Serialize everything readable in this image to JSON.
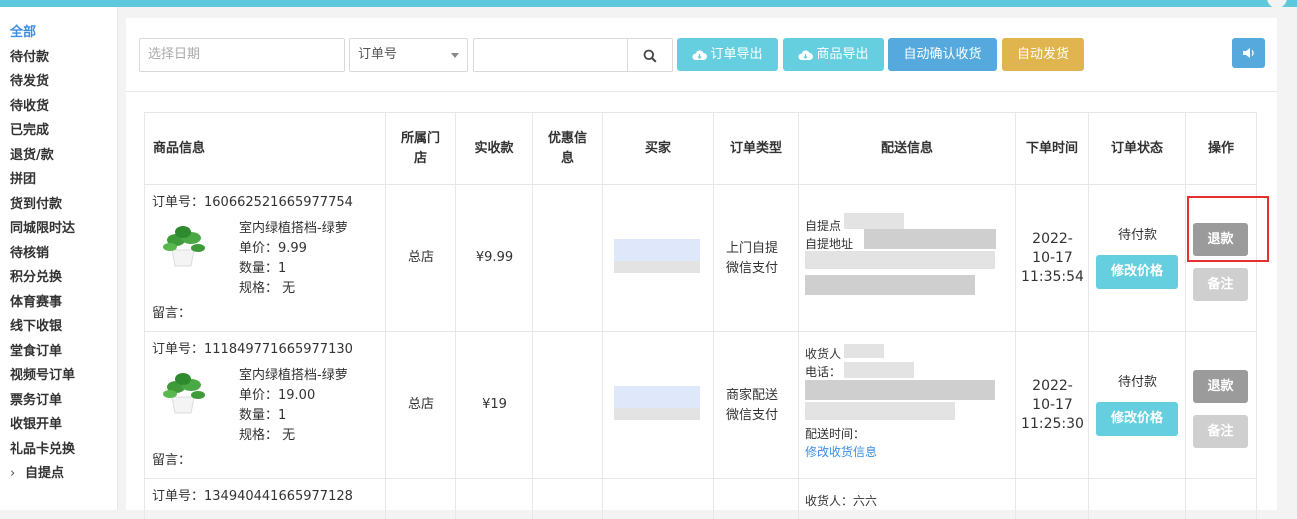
{
  "sidebar": {
    "items": [
      {
        "label": "全部",
        "active": true
      },
      {
        "label": "待付款"
      },
      {
        "label": "待发货"
      },
      {
        "label": "待收货"
      },
      {
        "label": "已完成"
      },
      {
        "label": "退货/款"
      },
      {
        "label": "拼团"
      },
      {
        "label": "货到付款"
      },
      {
        "label": "同城限时达"
      },
      {
        "label": "待核销"
      },
      {
        "label": "积分兑换"
      },
      {
        "label": "体育赛事"
      },
      {
        "label": "线下收银"
      },
      {
        "label": "堂食订单"
      },
      {
        "label": "视频号订单"
      },
      {
        "label": "票务订单"
      },
      {
        "label": "收银开单"
      },
      {
        "label": "礼品卡兑换"
      },
      {
        "label": "自提点"
      }
    ],
    "expand_glyph": "›"
  },
  "toolbar": {
    "date_placeholder": "选择日期",
    "select_value": "订单号",
    "search_value": "",
    "export_orders": "订单导出",
    "export_products": "商品导出",
    "auto_confirm": "自动确认收货",
    "auto_ship": "自动发货",
    "colors": {
      "teal": "#65cfe0",
      "blue": "#56a9dc",
      "gold": "#e0b44e"
    }
  },
  "table": {
    "headers": [
      "商品信息",
      "所属门店",
      "实收款",
      "优惠信息",
      "买家",
      "订单类型",
      "配送信息",
      "下单时间",
      "订单状态",
      "操作"
    ],
    "header_lines": [
      [
        "商品信息"
      ],
      [
        "所属门",
        "店"
      ],
      [
        "实收款"
      ],
      [
        "优惠信",
        "息"
      ],
      [
        "买家"
      ],
      [
        "订单类型"
      ],
      [
        "配送信息"
      ],
      [
        "下单时间"
      ],
      [
        "订单状态"
      ],
      [
        "操作"
      ]
    ],
    "rows": [
      {
        "order_no": "订单号：160662521665977754",
        "product_name": "室内绿植搭档-绿萝",
        "unit_price": "单价：9.99",
        "quantity": "数量：1",
        "spec": "规格： 无",
        "message": "留言：",
        "store": "总店",
        "amount": "¥9.99",
        "order_type": [
          "上门自提",
          "微信支付"
        ],
        "delivery": [
          "自提点",
          "自提地址"
        ],
        "time": [
          "2022-",
          "10-17",
          "11:35:54"
        ],
        "status": "待付款",
        "modify_price": "修改价格",
        "refund": "退款",
        "note": "备注"
      },
      {
        "order_no": "订单号：111849771665977130",
        "product_name": "室内绿植搭档-绿萝",
        "unit_price": "单价：19.00",
        "quantity": "数量：1",
        "spec": "规格： 无",
        "message": "留言：",
        "store": "总店",
        "amount": "¥19",
        "order_type": [
          "商家配送",
          "微信支付"
        ],
        "delivery": [
          "收货人",
          "电话：",
          "配送时间："
        ],
        "delivery_link": "修改收货信息",
        "time": [
          "2022-",
          "10-17",
          "11:25:30"
        ],
        "status": "待付款",
        "modify_price": "修改价格",
        "refund": "退款",
        "note": "备注"
      },
      {
        "order_no": "订单号：134940441665977128",
        "delivery": [
          "收货人：六六"
        ]
      }
    ]
  }
}
